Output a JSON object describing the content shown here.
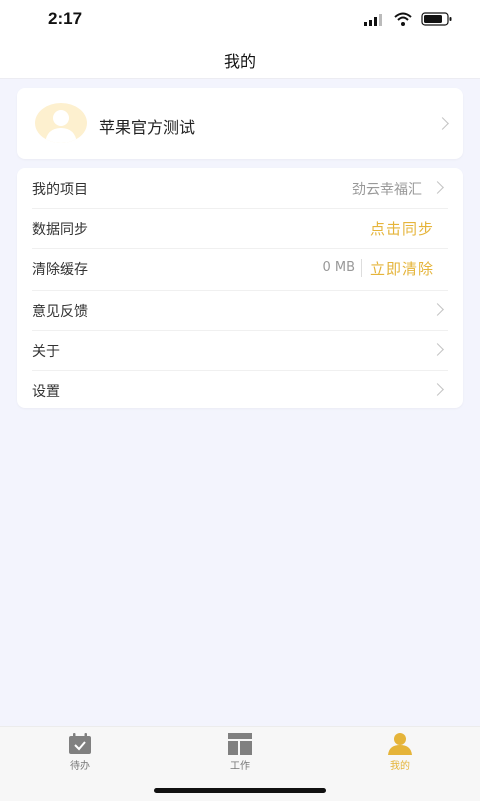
{
  "status": {
    "time": "2:17"
  },
  "nav": {
    "title": "我的"
  },
  "profile": {
    "name": "苹果官方测试"
  },
  "menu": {
    "project": {
      "label": "我的项目",
      "value": "劲云幸福汇"
    },
    "sync": {
      "label": "数据同步",
      "action": "点击同步"
    },
    "cache": {
      "label": "清除缓存",
      "size": "0 MB",
      "action": "立即清除"
    },
    "feedback": {
      "label": "意见反馈"
    },
    "about": {
      "label": "关于"
    },
    "settings": {
      "label": "设置"
    }
  },
  "tabs": [
    {
      "label": "待办",
      "icon": "calendar-check-icon"
    },
    {
      "label": "工作",
      "icon": "layout-grid-icon"
    },
    {
      "label": "我的",
      "icon": "user-icon",
      "active": true
    }
  ],
  "colors": {
    "accent": "#e5b43a",
    "background": "#f3f4fd",
    "tab_icon": "#808080"
  }
}
